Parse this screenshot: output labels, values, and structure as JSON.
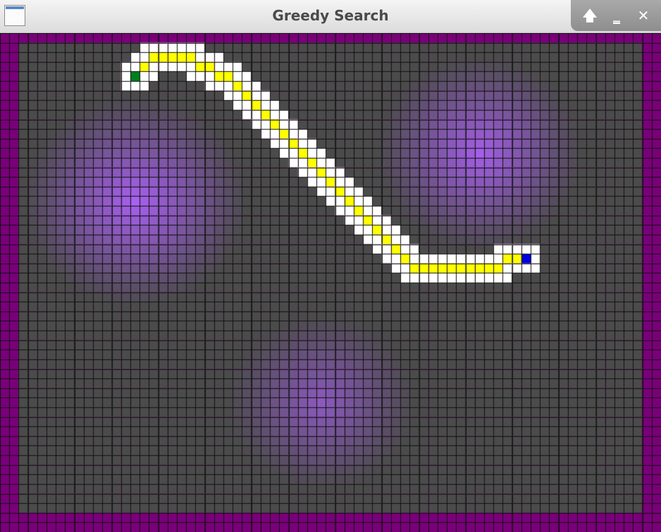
{
  "window": {
    "title": "Greedy Search",
    "icon": "app-window-icon"
  },
  "controls": {
    "maximize_icon": "arrow-up-icon",
    "minimize_icon": "minimize-icon",
    "close_icon": "close-icon",
    "maximize_glyph": "🡅",
    "minimize_glyph": "‗",
    "close_glyph": "✕"
  },
  "grid": {
    "columns": 71,
    "rows": 52,
    "colors": {
      "wall": "#7a007a",
      "cell_dark": "#4b4b4b",
      "cell_light": "#a860f0",
      "grid_line": "#111111",
      "path": "#ffff00",
      "explored": "#ffffff",
      "start": "#00801c",
      "goal": "#0000e0"
    },
    "start": [
      14,
      4
    ],
    "goal": [
      56,
      23
    ],
    "path": [
      [
        14,
        4
      ],
      [
        15,
        3
      ],
      [
        16,
        2
      ],
      [
        17,
        2
      ],
      [
        18,
        2
      ],
      [
        19,
        2
      ],
      [
        20,
        2
      ],
      [
        21,
        3
      ],
      [
        22,
        3
      ],
      [
        23,
        4
      ],
      [
        24,
        4
      ],
      [
        25,
        5
      ],
      [
        26,
        6
      ],
      [
        27,
        7
      ],
      [
        28,
        8
      ],
      [
        29,
        9
      ],
      [
        30,
        10
      ],
      [
        31,
        11
      ],
      [
        32,
        12
      ],
      [
        33,
        13
      ],
      [
        34,
        14
      ],
      [
        35,
        15
      ],
      [
        36,
        16
      ],
      [
        37,
        17
      ],
      [
        38,
        18
      ],
      [
        39,
        19
      ],
      [
        40,
        20
      ],
      [
        41,
        21
      ],
      [
        42,
        22
      ],
      [
        43,
        23
      ],
      [
        44,
        24
      ],
      [
        45,
        24
      ],
      [
        46,
        24
      ],
      [
        47,
        24
      ],
      [
        48,
        24
      ],
      [
        49,
        24
      ],
      [
        50,
        24
      ],
      [
        51,
        24
      ],
      [
        52,
        24
      ],
      [
        53,
        24
      ],
      [
        54,
        23
      ],
      [
        55,
        23
      ],
      [
        56,
        23
      ]
    ]
  }
}
